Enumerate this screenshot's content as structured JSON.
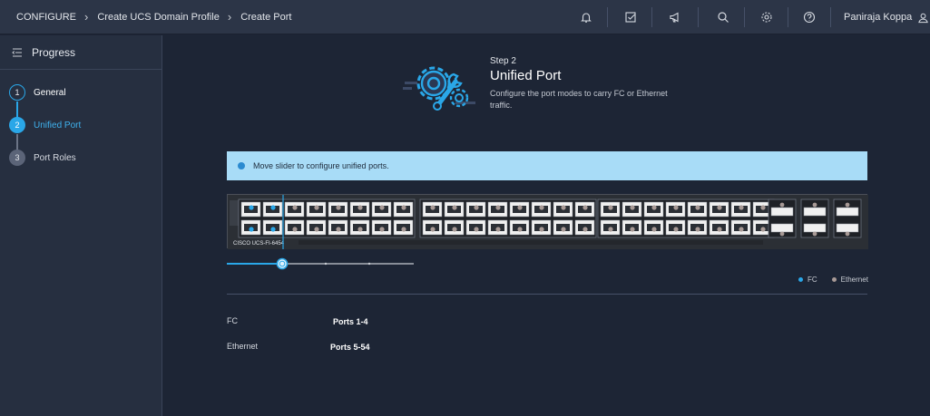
{
  "breadcrumb": {
    "items": [
      "CONFIGURE",
      "Create UCS Domain Profile",
      "Create Port"
    ]
  },
  "topbar": {
    "icons": [
      "bell-icon",
      "checklist-icon",
      "megaphone-icon",
      "search-icon",
      "gear-icon",
      "help-icon"
    ],
    "user_name": "Paniraja Koppa"
  },
  "sidebar": {
    "title": "Progress",
    "steps": [
      {
        "number": "1",
        "label": "General",
        "state": "done"
      },
      {
        "number": "2",
        "label": "Unified Port",
        "state": "active"
      },
      {
        "number": "3",
        "label": "Port Roles",
        "state": "pending"
      }
    ]
  },
  "main": {
    "step_label": "Step 2",
    "title": "Unified Port",
    "description": "Configure the port modes to carry FC or Ethernet traffic.",
    "info_banner": "Move slider to configure unified ports.",
    "switch_model": "CISCO UCS-FI-6454",
    "slider": {
      "fc_port_count": 4,
      "total_ports": 54
    },
    "legend": [
      {
        "label": "FC",
        "color": "#2aa7e8"
      },
      {
        "label": "Ethernet",
        "color": "#a89a96"
      }
    ],
    "summary": [
      {
        "label": "FC",
        "value": "Ports 1-4"
      },
      {
        "label": "Ethernet",
        "value": "Ports 5-54"
      }
    ]
  },
  "colors": {
    "accent": "#2aa7e8",
    "banner_bg": "#a8dcf7",
    "background": "#1d2535"
  }
}
